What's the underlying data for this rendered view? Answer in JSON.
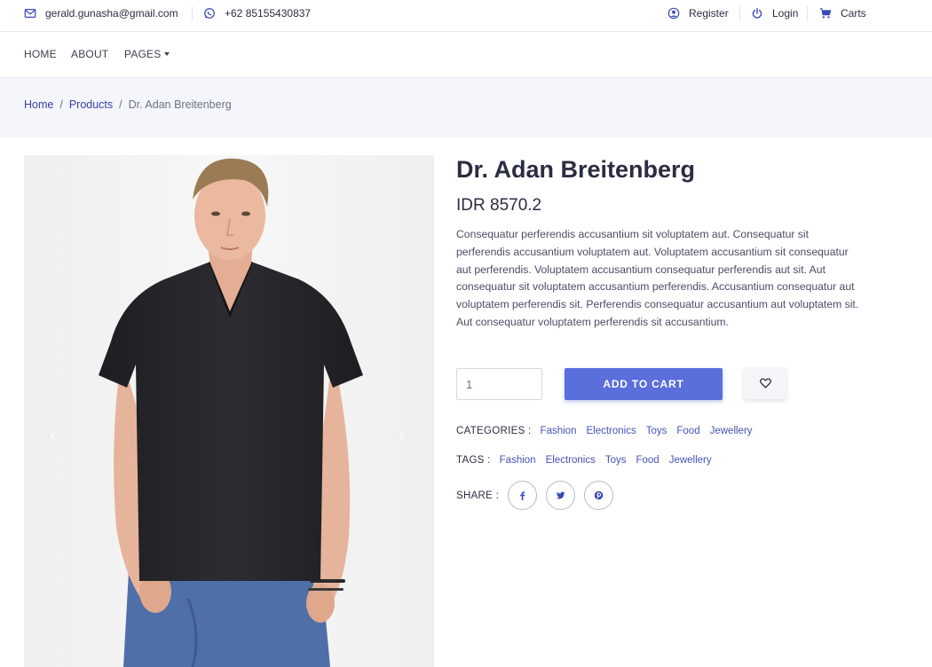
{
  "topbar": {
    "email": "gerald.gunasha@gmail.com",
    "phone": "+62 85155430837",
    "register": "Register",
    "login": "Login",
    "carts": "Carts"
  },
  "nav": {
    "home": "HOME",
    "about": "ABOUT",
    "pages": "PAGES"
  },
  "breadcrumb": {
    "home": "Home",
    "products": "Products",
    "current": "Dr. Adan Breitenberg",
    "separator": "/"
  },
  "gallery": {
    "prev": "‹",
    "next": "›"
  },
  "product": {
    "title": "Dr. Adan Breitenberg",
    "price": "IDR 8570.2",
    "description": "Consequatur perferendis accusantium sit voluptatem aut. Consequatur sit perferendis accusantium voluptatem aut. Voluptatem accusantium sit consequatur aut perferendis. Voluptatem accusantium consequatur perferendis aut sit. Aut consequatur sit voluptatem accusantium perferendis. Accusantium consequatur aut voluptatem perferendis sit. Perferendis consequatur accusantium aut voluptatem sit. Aut consequatur voluptatem perferendis sit accusantium.",
    "quantity": "1",
    "add_to_cart": "ADD TO CART"
  },
  "categories": {
    "label": "CATEGORIES :",
    "items": [
      "Fashion",
      "Electronics",
      "Toys",
      "Food",
      "Jewellery"
    ]
  },
  "tags": {
    "label": "TAGS :",
    "items": [
      "Fashion",
      "Electronics",
      "Toys",
      "Food",
      "Jewellery"
    ]
  },
  "share": {
    "label": "SHARE :",
    "icons": [
      "facebook-icon",
      "twitter-icon",
      "pinterest-icon"
    ]
  },
  "colors": {
    "accent": "#5a6edc",
    "link": "#4552b8",
    "text": "#2b2d42",
    "band": "#f4f6fb"
  }
}
